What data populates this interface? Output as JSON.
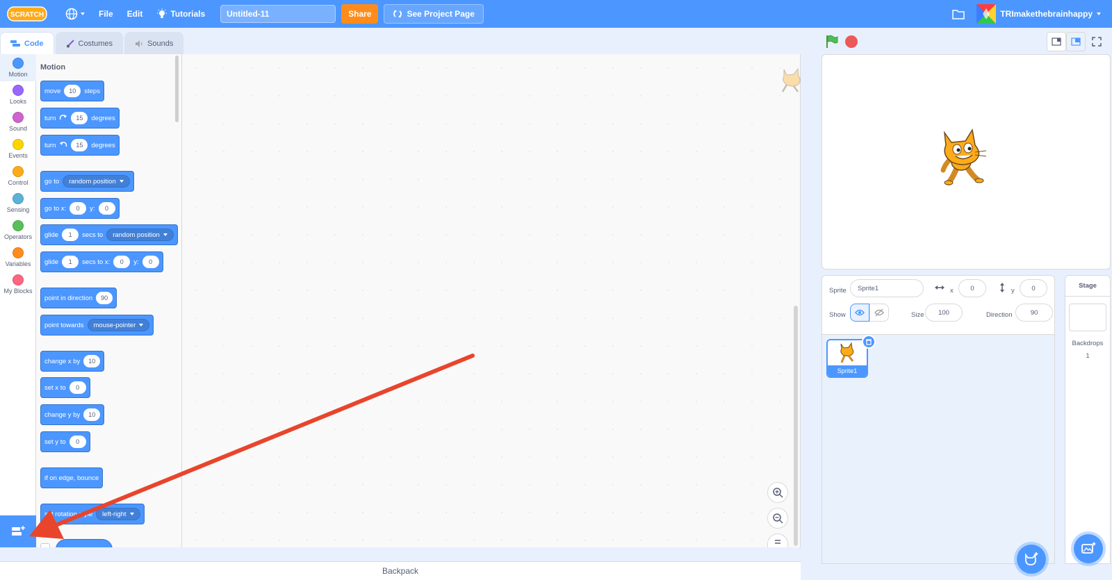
{
  "menubar": {
    "logo_text": "SCRATCH",
    "file_label": "File",
    "edit_label": "Edit",
    "tutorials_label": "Tutorials",
    "project_title": "Untitled-11",
    "share_label": "Share",
    "see_project_label": "See Project Page",
    "username": "TRImakethebrainhappy",
    "accent_color": "#4c97ff",
    "share_color": "#ff8c1a"
  },
  "tabs": [
    {
      "label": "Code",
      "icon": "code-icon",
      "active": true
    },
    {
      "label": "Costumes",
      "icon": "brush-icon",
      "active": false
    },
    {
      "label": "Sounds",
      "icon": "speaker-icon",
      "active": false
    }
  ],
  "categories": [
    {
      "label": "Motion",
      "color": "#4c97ff"
    },
    {
      "label": "Looks",
      "color": "#9966ff"
    },
    {
      "label": "Sound",
      "color": "#cf63cf"
    },
    {
      "label": "Events",
      "color": "#ffd500"
    },
    {
      "label": "Control",
      "color": "#ffab19"
    },
    {
      "label": "Sensing",
      "color": "#5cb1d6"
    },
    {
      "label": "Operators",
      "color": "#59c059"
    },
    {
      "label": "Variables",
      "color": "#ff8c1a"
    },
    {
      "label": "My Blocks",
      "color": "#ff6680"
    }
  ],
  "palette": {
    "title": "Motion",
    "blocks": {
      "move": {
        "a": "move",
        "v": "10",
        "b": "steps"
      },
      "turn_right": {
        "a": "turn",
        "v": "15",
        "b": "degrees"
      },
      "turn_left": {
        "a": "turn",
        "v": "15",
        "b": "degrees"
      },
      "goto": {
        "a": "go to",
        "menu": "random position"
      },
      "goto_xy": {
        "a": "go to x:",
        "x": "0",
        "b": "y:",
        "y": "0"
      },
      "glide_to": {
        "a": "glide",
        "v": "1",
        "b": "secs to",
        "menu": "random position"
      },
      "glide_xy": {
        "a": "glide",
        "v": "1",
        "b": "secs to x:",
        "x": "0",
        "c": "y:",
        "y": "0"
      },
      "point_dir": {
        "a": "point in direction",
        "v": "90"
      },
      "point_towards": {
        "a": "point towards",
        "menu": "mouse-pointer"
      },
      "change_x": {
        "a": "change x by",
        "v": "10"
      },
      "set_x": {
        "a": "set x to",
        "v": "0"
      },
      "change_y": {
        "a": "change y by",
        "v": "10"
      },
      "set_y": {
        "a": "set y to",
        "v": "0"
      },
      "bounce": {
        "a": "if on edge, bounce"
      },
      "rotation": {
        "a": "set rotation style",
        "menu": "left-right"
      }
    }
  },
  "backpack_label": "Backpack",
  "sprite_info": {
    "sprite_label": "Sprite",
    "sprite_name": "Sprite1",
    "x_label": "x",
    "x_value": "0",
    "y_label": "y",
    "y_value": "0",
    "show_label": "Show",
    "size_label": "Size",
    "size_value": "100",
    "direction_label": "Direction",
    "direction_value": "90"
  },
  "sprites": [
    {
      "name": "Sprite1",
      "selected": true
    }
  ],
  "stage_panel": {
    "title": "Stage",
    "backdrops_label": "Backdrops",
    "backdrops_count": "1"
  },
  "annotation_color": "#e8452c"
}
